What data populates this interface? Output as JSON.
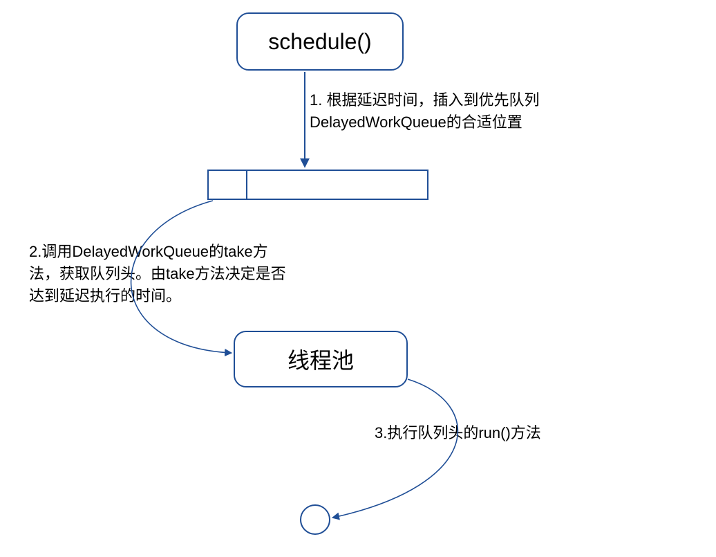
{
  "nodes": {
    "schedule": {
      "label": "schedule()"
    },
    "threadpool": {
      "label": "线程池"
    }
  },
  "annotations": {
    "step1": "1. 根据延迟时间，插入到优先队列DelayedWorkQueue的合适位置",
    "step2": "2.调用DelayedWorkQueue的take方法，获取队列头。由take方法决定是否达到延迟执行的时间。",
    "step3": "3.执行队列头的run()方法"
  },
  "colors": {
    "border": "#1f4e96",
    "text": "#000000"
  }
}
